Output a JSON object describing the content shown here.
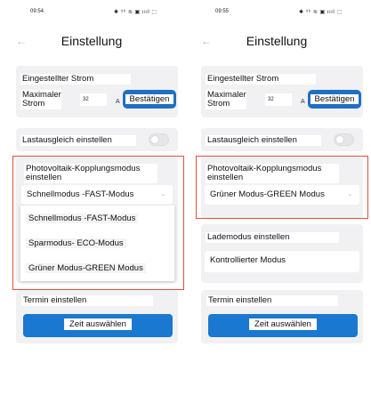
{
  "left": {
    "status": {
      "time": "09:54",
      "icons": "✱ ⁵⁶ ≋ ▣ ıııl ⬚"
    },
    "header": {
      "back_icon": "←",
      "title": "Einstellung"
    },
    "current": {
      "section_label": "Eingestellter Strom",
      "max_label": "Maximaler Strom",
      "max_value": "32",
      "unit": "A",
      "confirm_label": "Bestätigen"
    },
    "load_balance": {
      "label": "Lastausgleich einstellen"
    },
    "pv_mode": {
      "label": "Photovoltaik-Kopplungsmodus einstellen",
      "selected": "Schnellmodus -FAST-Modus",
      "options": [
        "Schnellmodus -FAST-Modus",
        "Sparmodus- ECO-Modus",
        "Grüner Modus-GREEN Modus"
      ]
    },
    "schedule": {
      "label": "Termin einstellen",
      "button_label": "Zeit auswählen"
    }
  },
  "right": {
    "status": {
      "time": "09:55",
      "icons": "✱ ⁵⁶ ≋ ▣ ıııl ⬚"
    },
    "header": {
      "back_icon": "←",
      "title": "Einstellung"
    },
    "current": {
      "section_label": "Eingestellter Strom",
      "max_label": "Maximaler Strom",
      "max_value": "32",
      "unit": "A",
      "confirm_label": "Bestätigen"
    },
    "load_balance": {
      "label": "Lastausgleich einstellen"
    },
    "pv_mode": {
      "label": "Photovoltaik-Kopplungsmodus einstellen",
      "selected": "Grüner Modus-GREEN Modus"
    },
    "charge_mode": {
      "label": "Lademodus einstellen",
      "selected": "Kontrollierter Modus"
    },
    "schedule": {
      "label": "Termin einstellen",
      "button_label": "Zeit auswählen"
    }
  },
  "colors": {
    "primary": "#1a78d0",
    "highlight": "#e0503e",
    "card": "#f1f1f3"
  }
}
